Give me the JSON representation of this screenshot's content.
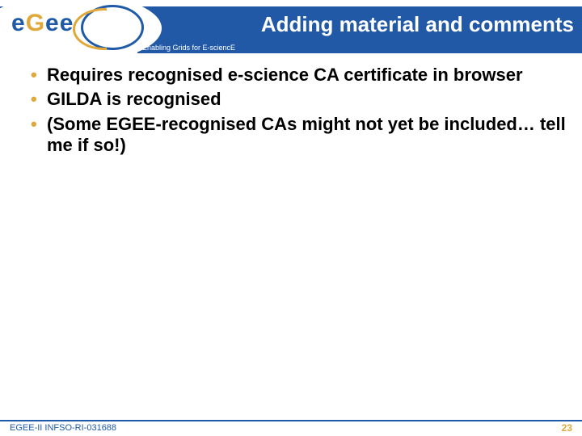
{
  "logo": {
    "text_parts": [
      "e",
      "G",
      "e",
      "e"
    ]
  },
  "header": {
    "title": "Adding material and comments",
    "tagline": "Enabling Grids for E-sciencE"
  },
  "bullets": [
    "Requires recognised e-science CA certificate in browser",
    "GILDA is recognised",
    "(Some EGEE-recognised CAs might not yet be included… tell me if so!)"
  ],
  "footer": {
    "left": "EGEE-II INFSO-RI-031688",
    "page": "23"
  }
}
